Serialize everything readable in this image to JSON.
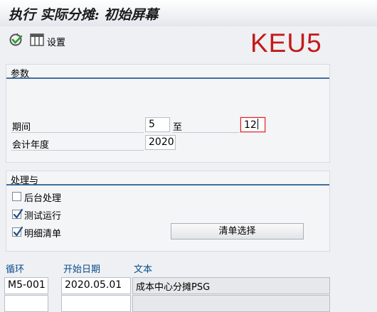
{
  "window": {
    "title": "执行 实际分摊: 初始屏幕"
  },
  "toolbar": {
    "settings_label": "设置",
    "transaction_code": "KEU5"
  },
  "params": {
    "title": "参数",
    "period_label": "期间",
    "period_from": "5",
    "to_label": "至",
    "period_to": "12",
    "year_label": "会计年度",
    "year": "2020"
  },
  "processing": {
    "title": "处理与",
    "options": [
      {
        "label": "后台处理",
        "checked": false
      },
      {
        "label": "测试运行",
        "checked": true
      },
      {
        "label": "明细清单",
        "checked": true
      }
    ],
    "list_button": "清单选择"
  },
  "cycles": {
    "headers": [
      "循环",
      "开始日期",
      "文本"
    ],
    "rows": [
      [
        "M5-001",
        "2020.05.01",
        "成本中心分摊PSG"
      ],
      [
        "",
        "",
        ""
      ]
    ]
  }
}
